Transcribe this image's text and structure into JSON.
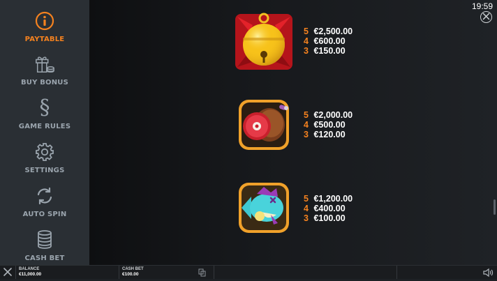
{
  "sidebar": {
    "items": [
      {
        "label": "PAYTABLE",
        "icon": "info-icon",
        "active": true
      },
      {
        "label": "BUY BONUS",
        "icon": "gift-coins-icon"
      },
      {
        "label": "GAME RULES",
        "icon": "section-sign-icon"
      },
      {
        "label": "SETTINGS",
        "icon": "gear-icon"
      },
      {
        "label": "AUTO SPIN",
        "icon": "refresh-icon"
      },
      {
        "label": "CASH BET",
        "icon": "coin-stack-icon"
      }
    ]
  },
  "header": {
    "clock": "19:59"
  },
  "paytable": {
    "symbols": [
      {
        "icon": "golden-bell-icon",
        "payouts": [
          {
            "count": "5",
            "amount": "€2,500.00"
          },
          {
            "count": "4",
            "amount": "€600.00"
          },
          {
            "count": "3",
            "amount": "€150.00"
          }
        ]
      },
      {
        "icon": "ham-icon",
        "payouts": [
          {
            "count": "5",
            "amount": "€2,000.00"
          },
          {
            "count": "4",
            "amount": "€500.00"
          },
          {
            "count": "3",
            "amount": "€120.00"
          }
        ]
      },
      {
        "icon": "fish-icon",
        "payouts": [
          {
            "count": "5",
            "amount": "€1,200.00"
          },
          {
            "count": "4",
            "amount": "€400.00"
          },
          {
            "count": "3",
            "amount": "€100.00"
          }
        ]
      }
    ]
  },
  "bottombar": {
    "balance_label": "BALANCE",
    "balance_value": "€11,000.00",
    "cashbet_label": "CASH BET",
    "cashbet_value": "€100.00"
  },
  "colors": {
    "accent": "#f5821f",
    "sidebar_bg": "#2a2f34",
    "label_grey": "#9aa4ad"
  }
}
